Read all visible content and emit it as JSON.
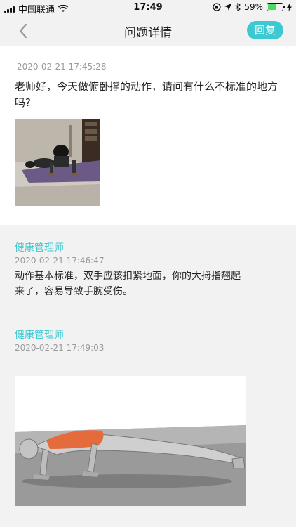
{
  "status_bar": {
    "carrier": "中国联通",
    "time": "17:49",
    "battery_percent": "59%",
    "battery_level": 0.59
  },
  "nav": {
    "title": "问题详情",
    "reply_label": "回复"
  },
  "question": {
    "time": "2020-02-21 17:45:28",
    "text": "老师好，今天做俯卧撑的动作，请问有什么不标准的地方吗?"
  },
  "answers": [
    {
      "author": "健康管理师",
      "time": "2020-02-21 17:46:47",
      "text": "动作基本标准，双手应该扣紧地面，你的大拇指翘起来了，容易导致手腕受伤。"
    },
    {
      "author": "健康管理师",
      "time": "2020-02-21 17:49:03"
    }
  ],
  "colors": {
    "accent": "#3cc9d2",
    "background": "#f2f2f2",
    "muted_text": "#9a9a9a"
  }
}
